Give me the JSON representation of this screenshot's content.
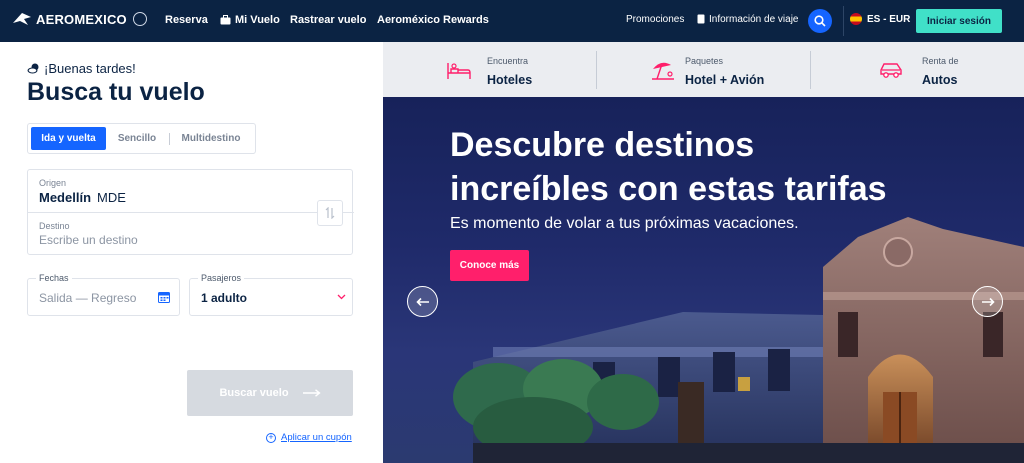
{
  "brand": {
    "name": "AEROMEXICO"
  },
  "nav": {
    "links": [
      "Reserva",
      "Mi Vuelo",
      "Rastrear vuelo",
      "Aeroméxico Rewards"
    ],
    "promotions": "Promociones",
    "travel_info": "Información de viaje",
    "language": "ES - EUR",
    "login": "Iniciar sesión"
  },
  "booking": {
    "greeting": "¡Buenas tardes!",
    "title": "Busca tu vuelo",
    "trip_types": [
      "Ida y vuelta",
      "Sencillo",
      "Multidestino"
    ],
    "selected_trip_type": "Ida y vuelta",
    "origin": {
      "label": "Origen",
      "city": "Medellín",
      "code": "MDE"
    },
    "destination": {
      "label": "Destino",
      "placeholder": "Escribe un destino"
    },
    "dates": {
      "label": "Fechas",
      "placeholder": "Salida — Regreso"
    },
    "passengers": {
      "label": "Pasajeros",
      "value": "1 adulto"
    },
    "search_button": "Buscar vuelo",
    "coupon_link": "Aplicar un cupón"
  },
  "services": [
    {
      "small": "Encuentra",
      "big": "Hoteles",
      "icon": "hotel-bed-icon"
    },
    {
      "small": "Paquetes",
      "big": "Hotel + Avión",
      "icon": "beach-umbrella-icon"
    },
    {
      "small": "Renta de",
      "big": "Autos",
      "icon": "car-icon"
    }
  ],
  "hero": {
    "title_line1": "Descubre destinos",
    "title_line2": "increíbles con estas tarifas",
    "subtitle": "Es momento de volar a tus próximas vacaciones.",
    "cta": "Conoce más"
  },
  "colors": {
    "navy": "#0b2343",
    "primary_blue": "#1565ff",
    "teal": "#40e0c8",
    "pink": "#ff1f6b",
    "disabled": "#d6dae0"
  }
}
